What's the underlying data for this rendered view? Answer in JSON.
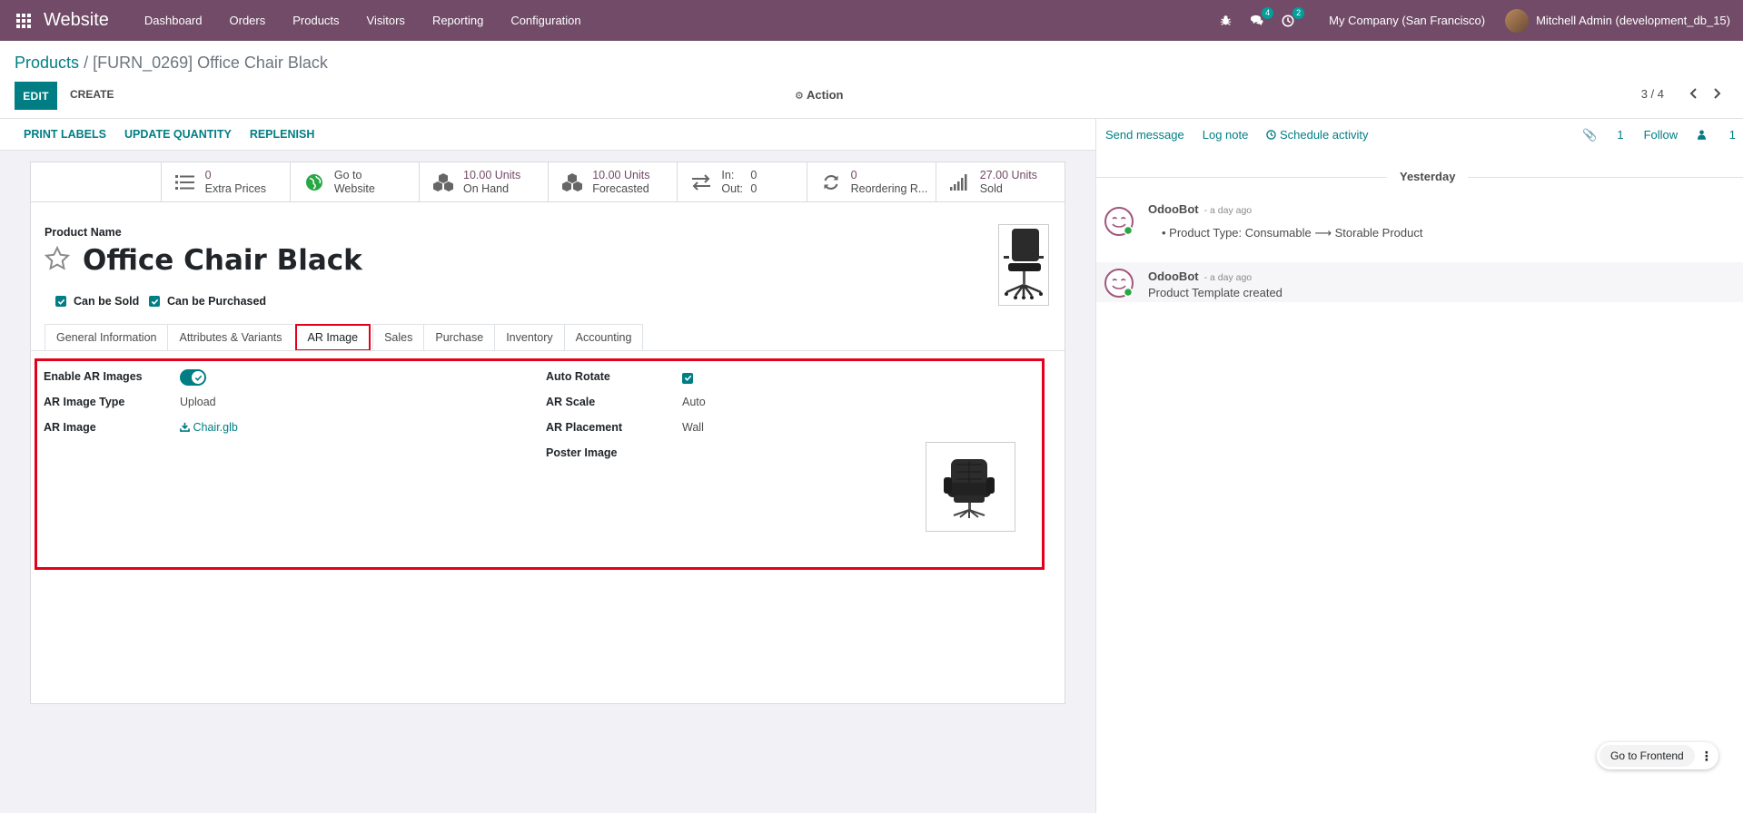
{
  "navbar": {
    "brand": "Website",
    "menu": [
      "Dashboard",
      "Orders",
      "Products",
      "Visitors",
      "Reporting",
      "Configuration"
    ],
    "messages_badge": "4",
    "activities_badge": "2",
    "company": "My Company (San Francisco)",
    "user": "Mitchell Admin (development_db_15)"
  },
  "control": {
    "breadcrumb_parent": "Products",
    "breadcrumb_sep": "/",
    "breadcrumb_current": "[FURN_0269] Office Chair Black",
    "edit_label": "EDIT",
    "create_label": "CREATE",
    "action_label": "Action",
    "pager": "3 / 4"
  },
  "statusbar": {
    "buttons": [
      "PRINT LABELS",
      "UPDATE QUANTITY",
      "REPLENISH"
    ]
  },
  "smart_buttons": [
    {
      "value": "0",
      "label": "Extra Prices",
      "icon": "list-icon"
    },
    {
      "value": "Go to",
      "label": "Website",
      "icon": "globe-icon"
    },
    {
      "value": "10.00 Units",
      "label": "On Hand",
      "icon": "cubes-icon"
    },
    {
      "value": "10.00 Units",
      "label": "Forecasted",
      "icon": "cubes-icon"
    },
    {
      "in_label": "In:",
      "in_value": "0",
      "out_label": "Out:",
      "out_value": "0",
      "icon": "exchange-icon"
    },
    {
      "value": "0",
      "label": "Reordering R...",
      "icon": "refresh-icon"
    },
    {
      "value": "27.00 Units",
      "label": "Sold",
      "icon": "signal-icon"
    }
  ],
  "product": {
    "name_label": "Product Name",
    "name": "Office Chair Black",
    "can_be_sold": "Can be Sold",
    "can_be_purchased": "Can be Purchased"
  },
  "tabs": [
    "General Information",
    "Attributes & Variants",
    "AR Image",
    "Sales",
    "Purchase",
    "Inventory",
    "Accounting"
  ],
  "active_tab": "AR Image",
  "ar": {
    "enable_label": "Enable AR Images",
    "enable_value": true,
    "type_label": "AR Image Type",
    "type_value": "Upload",
    "image_label": "AR Image",
    "image_value": "Chair.glb",
    "rotate_label": "Auto Rotate",
    "scale_label": "AR Scale",
    "scale_value": "Auto",
    "placement_label": "AR Placement",
    "placement_value": "Wall",
    "poster_label": "Poster Image"
  },
  "chatter": {
    "send_message": "Send message",
    "log_note": "Log note",
    "schedule_activity": "Schedule activity",
    "attachments": "1",
    "follow": "Follow",
    "followers": "1",
    "date_divider": "Yesterday",
    "messages": [
      {
        "author": "OdooBot",
        "time": "- a day ago",
        "from": "Product Type: Consumable",
        "to": "Storable Product"
      },
      {
        "author": "OdooBot",
        "time": "- a day ago",
        "body": "Product Template created"
      }
    ]
  },
  "frontend_button": "Go to Frontend",
  "colors": {
    "navbar": "#714b67",
    "primary": "#017e84",
    "highlight": "#e3001b"
  }
}
